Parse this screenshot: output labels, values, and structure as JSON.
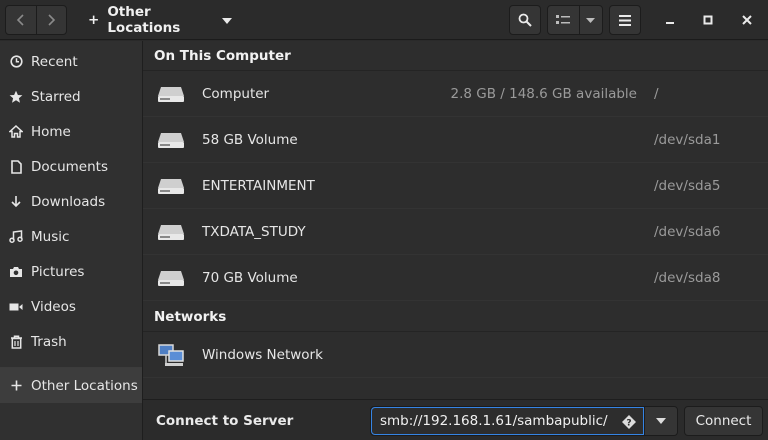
{
  "header": {
    "location_label": "Other Locations"
  },
  "sidebar": {
    "items": [
      {
        "label": "Recent",
        "icon": "clock-icon"
      },
      {
        "label": "Starred",
        "icon": "star-icon"
      },
      {
        "label": "Home",
        "icon": "home-icon"
      },
      {
        "label": "Documents",
        "icon": "document-icon"
      },
      {
        "label": "Downloads",
        "icon": "download-icon"
      },
      {
        "label": "Music",
        "icon": "music-icon"
      },
      {
        "label": "Pictures",
        "icon": "camera-icon"
      },
      {
        "label": "Videos",
        "icon": "video-icon"
      },
      {
        "label": "Trash",
        "icon": "trash-icon"
      },
      {
        "label": "Other Locations",
        "icon": "plus-icon"
      }
    ]
  },
  "main": {
    "section_computer": "On This Computer",
    "volumes": [
      {
        "name": "Computer",
        "available": "2.8 GB / 148.6 GB available",
        "device": "/"
      },
      {
        "name": "58 GB Volume",
        "available": "",
        "device": "/dev/sda1"
      },
      {
        "name": "ENTERTAINMENT",
        "available": "",
        "device": "/dev/sda5"
      },
      {
        "name": "TXDATA_STUDY",
        "available": "",
        "device": "/dev/sda6"
      },
      {
        "name": "70 GB Volume",
        "available": "",
        "device": "/dev/sda8"
      }
    ],
    "section_networks": "Networks",
    "networks": [
      {
        "name": "Windows Network"
      }
    ]
  },
  "connect": {
    "label": "Connect to Server",
    "address_value": "smb://192.168.1.61/sambapublic/",
    "button_label": "Connect"
  },
  "colors": {
    "accent": "#3584e4",
    "background": "#2d2d2d",
    "sidebar": "#303030"
  }
}
